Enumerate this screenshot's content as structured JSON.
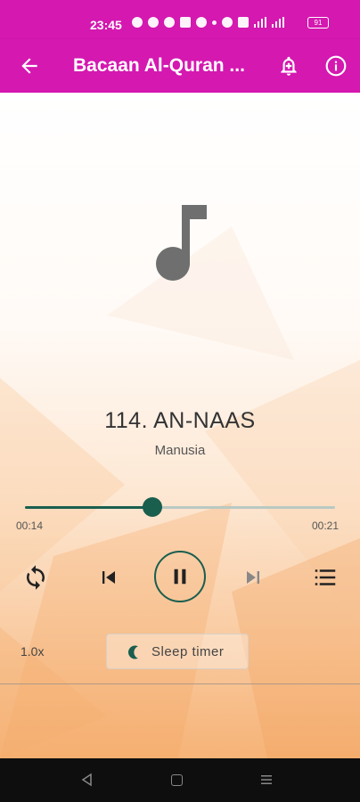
{
  "status_bar": {
    "time": "23:45",
    "battery": "91"
  },
  "app_bar": {
    "title": "Bacaan Al-Quran ...",
    "icons": [
      "back-arrow-icon",
      "bell-plus-icon",
      "info-icon"
    ]
  },
  "now_playing": {
    "title": "114. AN-NAAS",
    "subtitle": "Manusia",
    "elapsed": "00:14",
    "total": "00:21",
    "progress": 0.41
  },
  "controls": {
    "speed": "1.0x",
    "sleep_timer_label": "Sleep timer"
  },
  "colors": {
    "app_bar": "#d418b0",
    "accent": "#1a5e4e",
    "nav_bar": "#0e0e0e"
  }
}
